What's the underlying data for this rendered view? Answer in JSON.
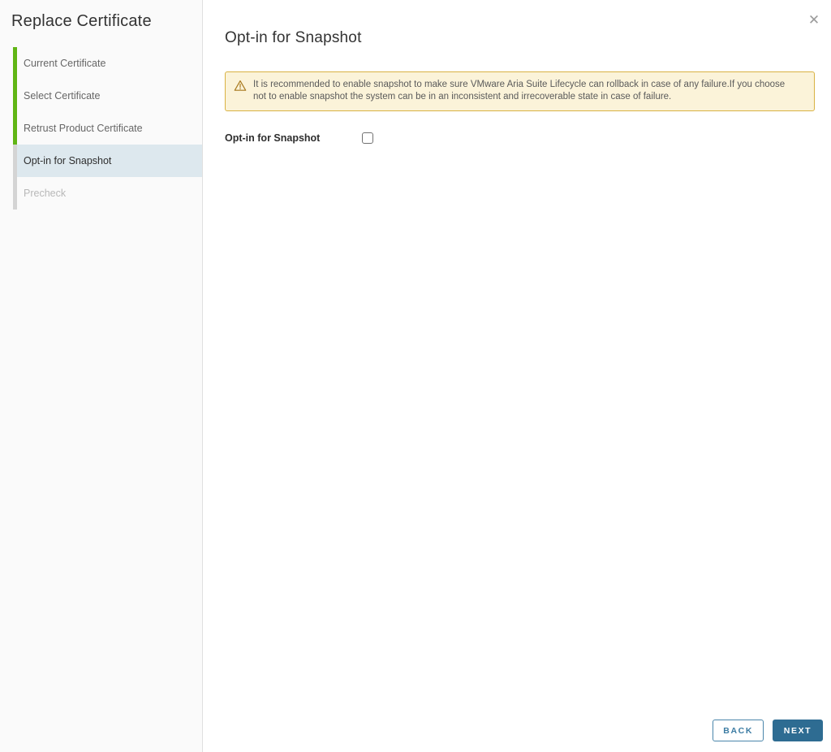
{
  "window": {
    "close_icon_glyph": "✕"
  },
  "sidebar": {
    "title": "Replace Certificate",
    "steps": [
      {
        "label": "Current Certificate",
        "state": "completed"
      },
      {
        "label": "Select Certificate",
        "state": "completed"
      },
      {
        "label": "Retrust Product Certificate",
        "state": "completed"
      },
      {
        "label": "Opt-in for Snapshot",
        "state": "active"
      },
      {
        "label": "Precheck",
        "state": "disabled"
      }
    ]
  },
  "main": {
    "heading": "Opt-in for Snapshot",
    "warning": {
      "icon": "warning-triangle-icon",
      "text": "It is recommended to enable snapshot to make sure VMware Aria Suite Lifecycle can rollback in case of any failure.If you choose not to enable snapshot the system can be in an inconsistent and irrecoverable state in case of failure."
    },
    "form": {
      "label": "Opt-in for Snapshot",
      "checkbox_checked": false
    }
  },
  "footer": {
    "back_label": "BACK",
    "next_label": "NEXT"
  },
  "colors": {
    "completed_step_bar": "#60b515",
    "pending_step_bar": "#d4d4d4",
    "active_step_bg": "#dde8ee",
    "warning_bg": "#fbf3d9",
    "warning_border": "#d9b243",
    "warning_icon": "#a8791e",
    "primary_button": "#2e6c92"
  }
}
